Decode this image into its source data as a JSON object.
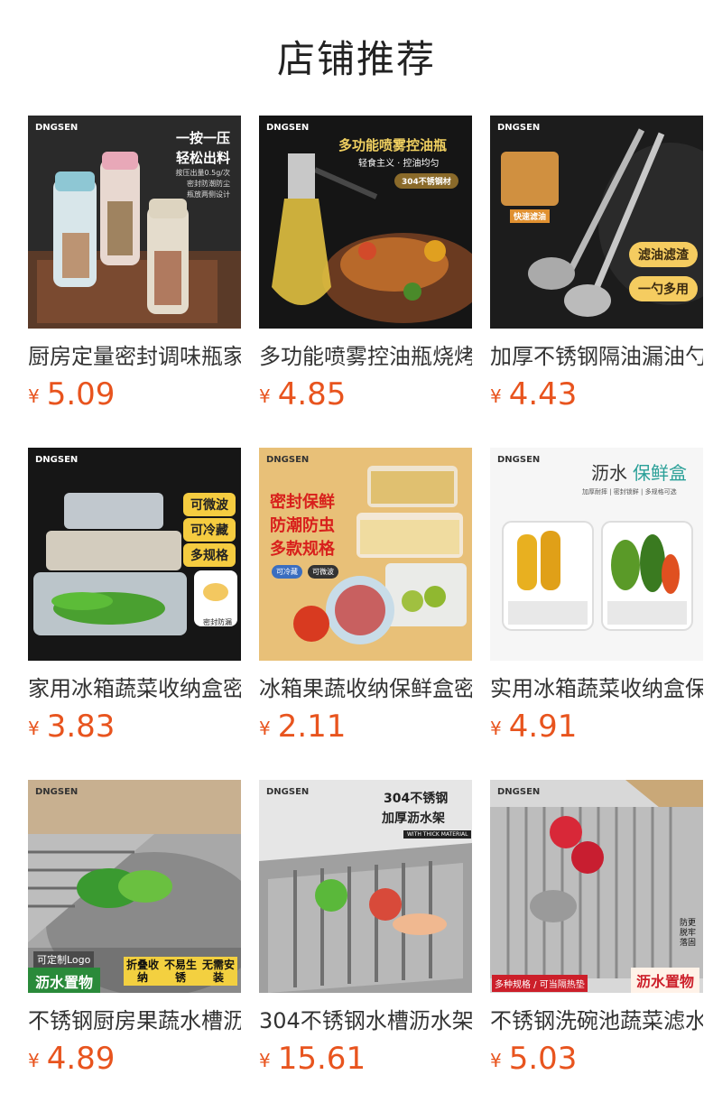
{
  "page": {
    "title": "店铺推荐"
  },
  "currency_symbol": "¥",
  "products": [
    {
      "name": "厨房定量密封调味瓶家用",
      "price": "5.09",
      "image": {
        "brand": "DNGSEN",
        "headline": "一按一压",
        "headline2": "轻松出料",
        "tags": [
          "按压出量0.5g/次",
          "密封防潮防尘",
          "瓶放两侧设计"
        ]
      }
    },
    {
      "name": "多功能喷雾控油瓶烧烤",
      "price": "4.85",
      "image": {
        "brand": "DNGSEN",
        "headline": "多功能喷雾控油瓶",
        "sub": "轻食主义 · 控油均匀",
        "badge": "304不锈钢材"
      }
    },
    {
      "name": "加厚不锈钢隔油漏油勺",
      "price": "4.43",
      "image": {
        "brand": "DNGSEN",
        "tag": "快速滤油",
        "pill1": "滤油滤渣",
        "pill2": "一勺多用"
      }
    },
    {
      "name": "家用冰箱蔬菜收纳盒密封",
      "price": "3.83",
      "image": {
        "brand": "DNGSEN",
        "pill1": "可微波",
        "pill2": "可冷藏",
        "pill3": "多规格",
        "small": "密封防漏"
      }
    },
    {
      "name": "冰箱果蔬收纳保鲜盒密封",
      "price": "2.11",
      "image": {
        "brand": "DNGSEN",
        "line1": "密封保鲜",
        "line2": "防潮防虫",
        "line3": "多款规格",
        "tag1": "可冷藏",
        "tag2": "可微波"
      }
    },
    {
      "name": "实用冰箱蔬菜收纳盒保鲜",
      "price": "4.91",
      "image": {
        "brand": "DNGSEN",
        "headline_a": "沥水",
        "headline_b": "保鲜盒",
        "sub": "加厚耐摔 | 密封锁鲜 | 多规格可选"
      }
    },
    {
      "name": "不锈钢厨房果蔬水槽沥水",
      "price": "4.89",
      "image": {
        "brand": "DNGSEN",
        "custom": "可定制Logo",
        "banner": "沥水置物",
        "features": [
          "折叠收纳",
          "不易生锈",
          "无需安装"
        ]
      }
    },
    {
      "name": "304不锈钢水槽沥水架",
      "price": "15.61",
      "image": {
        "brand": "DNGSEN",
        "headline": "304不锈钢",
        "headline2": "加厚沥水架",
        "sub": "WITH THICK MATERIAL"
      }
    },
    {
      "name": "不锈钢洗碗池蔬菜滤水架",
      "price": "5.03",
      "image": {
        "brand": "DNGSEN",
        "side": "防更脱牢落固",
        "bottom_left": "多种规格 / 可当隔热垫",
        "banner": "沥水置物"
      }
    }
  ]
}
